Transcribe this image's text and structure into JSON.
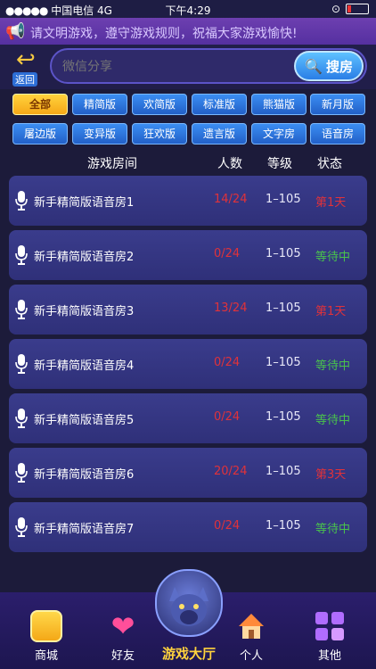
{
  "statusbar": {
    "carrier": "中国电信",
    "network": "4G",
    "time": "下午4:29"
  },
  "notice": "请文明游戏，遵守游戏规则，祝福大家游戏愉快!",
  "header": {
    "back_label": "返回",
    "search_placeholder": "微信分享",
    "search_button": "搜房"
  },
  "filters": [
    {
      "label": "全部",
      "active": true
    },
    {
      "label": "精简版",
      "active": false
    },
    {
      "label": "欢简版",
      "active": false
    },
    {
      "label": "标准版",
      "active": false
    },
    {
      "label": "熊猫版",
      "active": false
    },
    {
      "label": "新月版",
      "active": false
    },
    {
      "label": "屠边版",
      "active": false
    },
    {
      "label": "变异版",
      "active": false
    },
    {
      "label": "狂欢版",
      "active": false
    },
    {
      "label": "遗言版",
      "active": false
    },
    {
      "label": "文字房",
      "active": false
    },
    {
      "label": "语音房",
      "active": false
    }
  ],
  "table": {
    "columns": [
      "游戏房间",
      "人数",
      "等级",
      "状态"
    ],
    "rows": [
      {
        "name": "新手精简版语音房1",
        "count": "14/24",
        "level": "1–105",
        "status": "第1天",
        "status_type": "day"
      },
      {
        "name": "新手精简版语音房2",
        "count": "0/24",
        "level": "1–105",
        "status": "等待中",
        "status_type": "wait"
      },
      {
        "name": "新手精简版语音房3",
        "count": "13/24",
        "level": "1–105",
        "status": "第1天",
        "status_type": "day"
      },
      {
        "name": "新手精简版语音房4",
        "count": "0/24",
        "level": "1–105",
        "status": "等待中",
        "status_type": "wait"
      },
      {
        "name": "新手精简版语音房5",
        "count": "0/24",
        "level": "1–105",
        "status": "等待中",
        "status_type": "wait"
      },
      {
        "name": "新手精简版语音房6",
        "count": "20/24",
        "level": "1–105",
        "status": "第3天",
        "status_type": "day"
      },
      {
        "name": "新手精简版语音房7",
        "count": "0/24",
        "level": "1–105",
        "status": "等待中",
        "status_type": "wait"
      }
    ]
  },
  "bottomnav": {
    "shop": "商城",
    "friends": "好友",
    "lobby": "游戏大厅",
    "profile": "个人",
    "other": "其他"
  },
  "colors": {
    "accent_yellow": "#ffd23d",
    "chip_blue": "#2f74dc",
    "red": "#e0323a",
    "green": "#49c24c"
  }
}
